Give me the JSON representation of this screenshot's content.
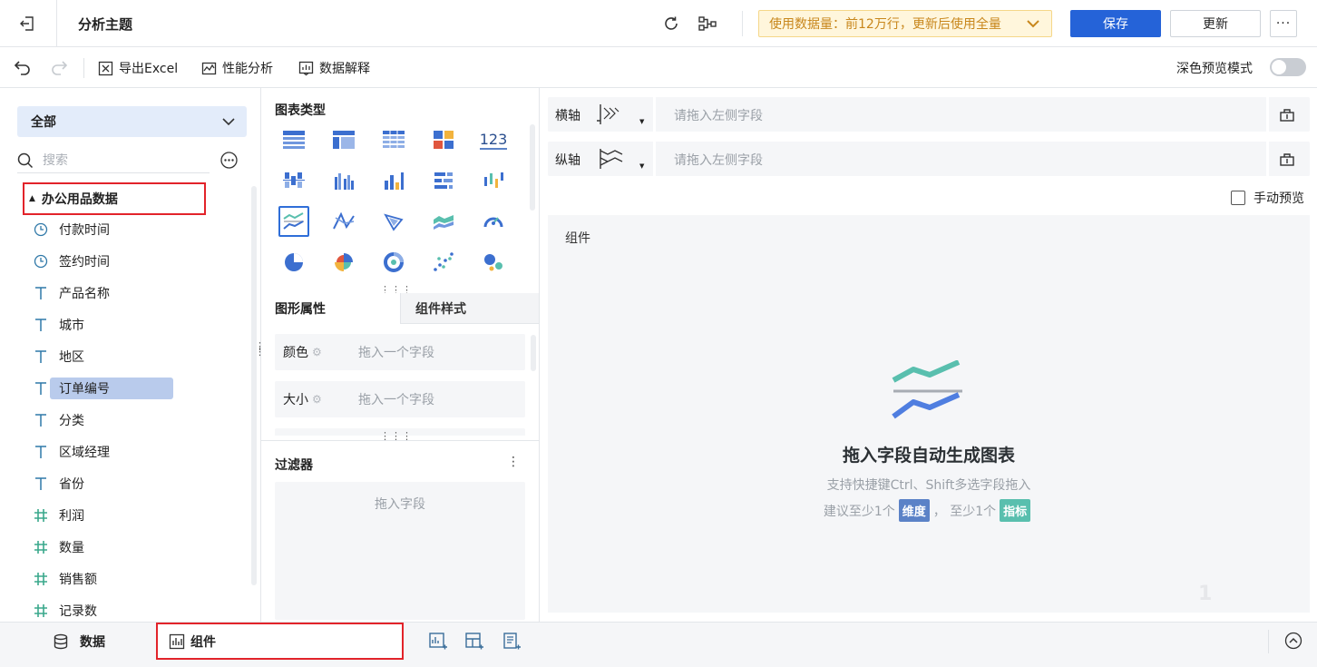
{
  "header": {
    "title": "分析主题",
    "data_notice": "使用数据量：前12万行，更新后使用全量",
    "save_label": "保存",
    "update_label": "更新",
    "more_label": "···"
  },
  "toolbar": {
    "export_label": "导出Excel",
    "perf_label": "性能分析",
    "explain_label": "数据解释",
    "dark_preview_label": "深色预览模式",
    "dark_preview_on": false
  },
  "data_panel": {
    "scope": "全部",
    "search_placeholder": "搜索",
    "dataset": "办公用品数据",
    "fields": [
      {
        "label": "付款时间",
        "type": "date"
      },
      {
        "label": "签约时间",
        "type": "date"
      },
      {
        "label": "产品名称",
        "type": "text"
      },
      {
        "label": "城市",
        "type": "text"
      },
      {
        "label": "地区",
        "type": "text"
      },
      {
        "label": "订单编号",
        "type": "text",
        "selected": true
      },
      {
        "label": "分类",
        "type": "text"
      },
      {
        "label": "区域经理",
        "type": "text"
      },
      {
        "label": "省份",
        "type": "text"
      },
      {
        "label": "利润",
        "type": "number"
      },
      {
        "label": "数量",
        "type": "number"
      },
      {
        "label": "销售额",
        "type": "number"
      },
      {
        "label": "记录数",
        "type": "number"
      }
    ]
  },
  "chart_config": {
    "chart_types_title": "图表类型",
    "number_card_label": "123",
    "tab_shape_props": "图形属性",
    "tab_component_style": "组件样式",
    "color_label": "颜色",
    "color_placeholder": "拖入一个字段",
    "size_label": "大小",
    "size_placeholder": "拖入一个字段",
    "filter_title": "过滤器",
    "filter_placeholder": "拖入字段"
  },
  "canvas": {
    "x_axis_label": "横轴",
    "x_axis_placeholder": "请拖入左侧字段",
    "y_axis_label": "纵轴",
    "y_axis_placeholder": "请拖入左侧字段",
    "manual_preview_label": "手动预览",
    "component_title": "组件",
    "empty_title": "拖入字段自动生成图表",
    "empty_hint": "支持快捷键Ctrl、Shift多选字段拖入",
    "suggest_prefix": "建议至少1个",
    "dimension_badge": "维度",
    "suggest_middle": "，  至少1个",
    "measure_badge": "指标",
    "watermark": "1"
  },
  "bottom": {
    "data_tab": "数据",
    "component_tab": "组件"
  },
  "colors": {
    "primary": "#2563d8",
    "highlight_border": "#e2232a",
    "warning_bg": "#fff6dc",
    "warning_text": "#c8871c",
    "dimension": "#5b82c7",
    "measure": "#59bfae"
  }
}
